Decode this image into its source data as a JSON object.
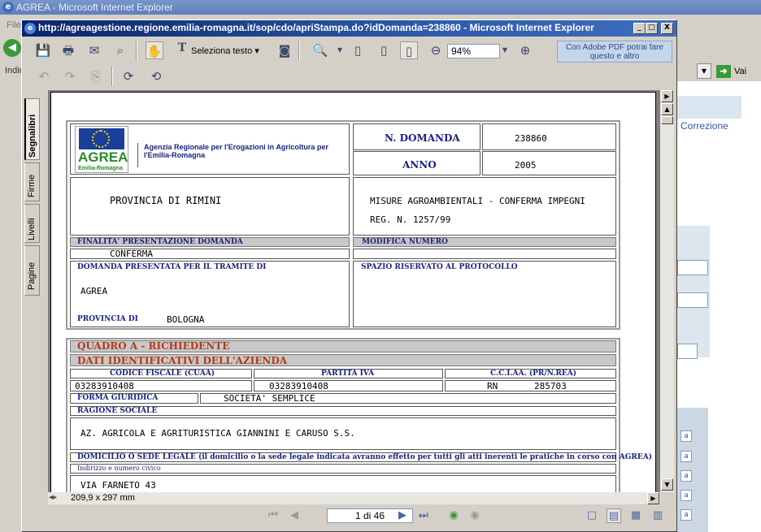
{
  "background_window": {
    "title": "AGREA - Microsoft Internet Explorer",
    "menu_first": "File",
    "address_label": "Indirizzo",
    "go_label": "Vai",
    "right_link": "Correzione",
    "cell_letter": "a"
  },
  "window": {
    "title": "http://agreagestione.regione.emilia-romagna.it/sop/cdo/apriStampa.do?idDomanda=238860 - Microsoft Internet Explorer",
    "minimize": "_",
    "maximize": "□",
    "close": "X"
  },
  "toolbar": {
    "select_text_label": "Seleziona testo",
    "zoom_value": "94%",
    "adobe_promo": "Con Adobe PDF potrai fare questo e altro"
  },
  "side_tabs": [
    "Segnalibri",
    "Firme",
    "Livelli",
    "Pagine"
  ],
  "status": {
    "page_size": "209,9 x 297 mm",
    "page_indicator": "1 di 46"
  },
  "form": {
    "logo_text": "AGREA",
    "logo_sub": "Emilia-Romagna",
    "agency": "Agenzia Regionale per l'Erogazioni in Agricoltura per l'Emilia-Romagna",
    "domanda_label": "N. DOMANDA",
    "domanda_value": "238860",
    "anno_label": "ANNO",
    "anno_value": "2005",
    "provincia": "PROVINCIA DI RIMINI",
    "misure_line1": "MISURE AGROAMBIENTALI - CONFERMA IMPEGNI",
    "misure_line2": "REG. N. 1257/99",
    "finalita_label": "FINALITA' PRESENTAZIONE DOMANDA",
    "finalita_value": "CONFERMA",
    "modifica_label": "MODIFICA NUMERO",
    "tramite_label": "DOMANDA PRESENTATA PER IL TRAMITE DI",
    "tramite_value": "AGREA",
    "provincia_di_label": "PROVINCIA DI",
    "provincia_di_value": "BOLOGNA",
    "protocollo_label": "SPAZIO RISERVATO AL PROTOCOLLO",
    "quadro_a": "QUADRO A - RICHIEDENTE",
    "dati_identificativi": "DATI IDENTIFICATIVI DELL'AZIENDA",
    "cf_label": "CODICE FISCALE (CUAA)",
    "cf_value": "03283910408",
    "piva_label": "PARTITA IVA",
    "piva_value": "03283910408",
    "cciaa_label": "C.C.I.AA. (PR/N.REA)",
    "cciaa_pr": "RN",
    "cciaa_rea": "285703",
    "forma_label": "FORMA GIURIDICA",
    "forma_value": "SOCIETA' SEMPLICE",
    "ragione_label": "RAGIONE SOCIALE",
    "ragione_value": "AZ. AGRICOLA E AGRITURISTICA GIANNINI E CARUSO S.S.",
    "domicilio_label": "DOMICILIO O SEDE LEGALE (il domicilio o la sede legale indicata avranno effetto per tutti gli atti inerenti le pratiche in corso con AGREA)",
    "indirizzo_label": "Indirizzo e numero civico",
    "indirizzo_value": "VIA FARNETO 43"
  }
}
